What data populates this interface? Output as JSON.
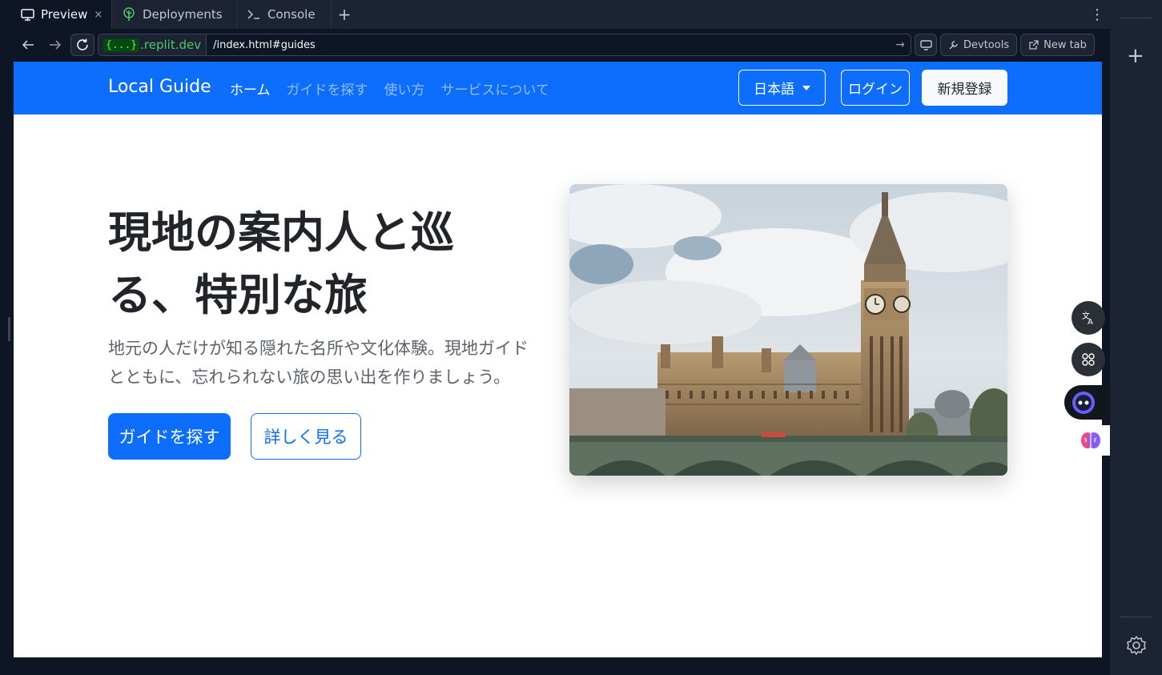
{
  "tabs": [
    {
      "label": "Preview",
      "icon": "monitor-icon",
      "active": true
    },
    {
      "label": "Deployments",
      "icon": "deploy-tree-icon",
      "active": false
    },
    {
      "label": "Console",
      "icon": "terminal-icon",
      "active": false
    }
  ],
  "tab_close": "×",
  "tab_add": "+",
  "tab_menu": "⋮",
  "address": {
    "host_badge": "{...}",
    "host_domain": ".replit.dev",
    "path": "/index.html#guides",
    "go_arrow": "→"
  },
  "toolbar": {
    "devtools_label": "Devtools",
    "newtab_label": "New tab"
  },
  "site": {
    "brand": "Local Guide",
    "nav": [
      "ホーム",
      "ガイドを探す",
      "使い方",
      "サービスについて"
    ],
    "nav_active_index": 0,
    "language_label": "日本語",
    "login_label": "ログイン",
    "signup_label": "新規登録",
    "hero_title": "現地の案内人と巡る、特別な旅",
    "hero_subtitle": "地元の人だけが知る隠れた名所や文化体験。現地ガイドとともに、忘れられない旅の思い出を作りましょう。",
    "primary_cta": "ガイドを探す",
    "secondary_cta": "詳しく見る",
    "hero_image": "big-ben-westminster-photo"
  },
  "colors": {
    "ide_bg": "#0e1525",
    "ide_panel": "#1c2333",
    "brand_blue": "#0d6efd",
    "text_dark": "#212529"
  },
  "widgets": [
    "translate-icon",
    "apps-grid-icon",
    "assistant-robot-icon",
    "brain-icon"
  ]
}
